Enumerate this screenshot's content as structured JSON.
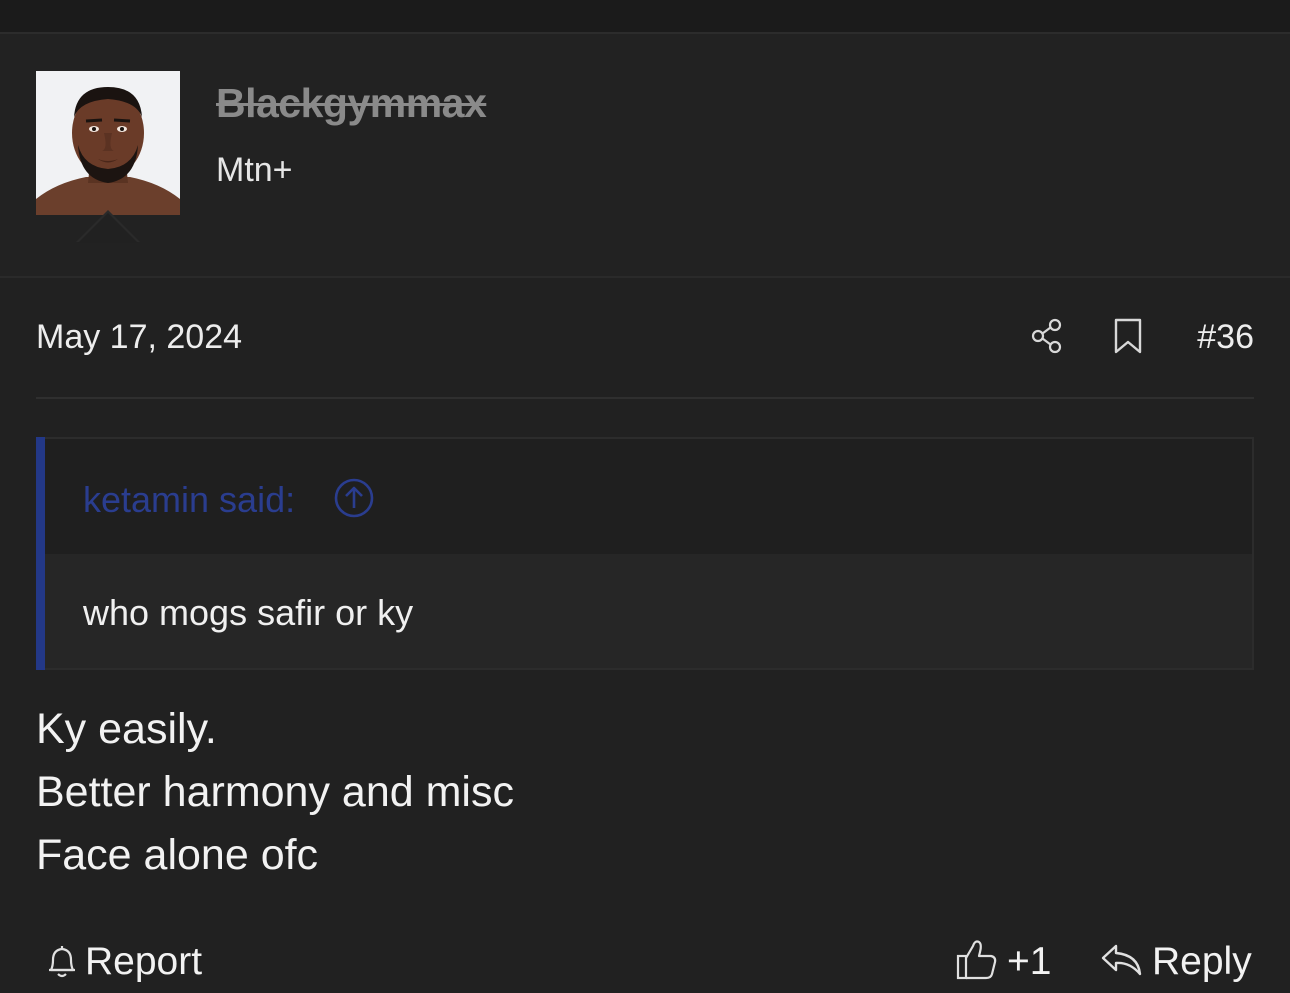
{
  "user": {
    "username": "Blackgymmax",
    "title": "Mtn+",
    "avatar_icon": "user-avatar-photo"
  },
  "post": {
    "date": "May 17, 2024",
    "number": "#36",
    "share_icon": "share-icon",
    "bookmark_icon": "bookmark-icon"
  },
  "quote": {
    "author": "ketamin said:",
    "text": "who mogs safir or ky",
    "accent_color": "#233887",
    "author_color": "#2a3d8f"
  },
  "body": {
    "lines": [
      "Ky easily.",
      "Better harmony and misc",
      "Face alone ofc"
    ]
  },
  "actions": {
    "report_label": "Report",
    "like_count": "+1",
    "reply_label": "Reply"
  },
  "colors": {
    "background": "#212121",
    "text": "#ececec",
    "username_struck": "#8a8a8a"
  }
}
